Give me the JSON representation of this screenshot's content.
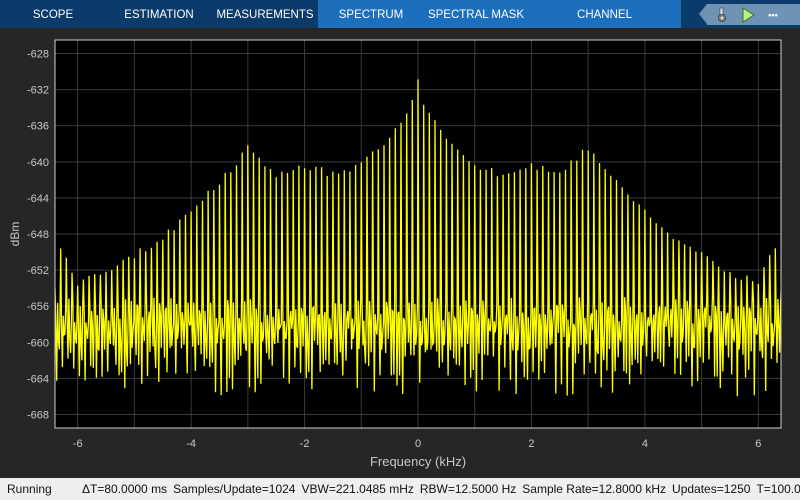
{
  "tabs": [
    {
      "label": "SCOPE",
      "active": false
    },
    {
      "label": "ESTIMATION",
      "active": false
    },
    {
      "label": "MEASUREMENTS",
      "active": false
    },
    {
      "label": "SPECTRUM",
      "active": true
    },
    {
      "label": "SPECTRAL MASK",
      "active": true
    },
    {
      "label": "CHANNEL MEASUREMENTS",
      "active": true
    }
  ],
  "toolbar": {
    "icons": [
      "settings-icon",
      "run-icon",
      "more-icon"
    ],
    "more_label": "•••"
  },
  "colors": {
    "tabbar": "#0b3b6a",
    "tab_active": "#1c6fbd",
    "trace": "#ffff00",
    "plot_bg": "#000000",
    "figure_bg": "#262626",
    "status_bg": "#efefef"
  },
  "chart_data": {
    "type": "line",
    "title": "",
    "xlabel": "Frequency (kHz)",
    "ylabel": "dBm",
    "xlim": [
      -6.4,
      6.4
    ],
    "ylim": [
      -669.5,
      -626.5
    ],
    "xticks": [
      -6,
      -4,
      -2,
      0,
      2,
      4,
      6
    ],
    "yticks": [
      -628,
      -632,
      -636,
      -640,
      -644,
      -648,
      -652,
      -656,
      -660,
      -664,
      -668
    ],
    "grid": true,
    "series": [
      {
        "color": "#ffff00",
        "line_spacing_khz": 0.1,
        "peak_envelope": [
          [
            0,
            -630.5
          ],
          [
            0.1,
            -633
          ],
          [
            0.2,
            -634
          ],
          [
            0.5,
            -637
          ],
          [
            1,
            -640
          ],
          [
            1.5,
            -641
          ],
          [
            2,
            -640
          ],
          [
            2.5,
            -641
          ],
          [
            3,
            -638
          ],
          [
            3.5,
            -642
          ],
          [
            4,
            -645
          ],
          [
            4.5,
            -648
          ],
          [
            5,
            -650
          ],
          [
            5.5,
            -652
          ],
          [
            6,
            -653
          ],
          [
            6.3,
            -649
          ],
          [
            6.4,
            -654
          ]
        ],
        "noise_floor_upper": -655,
        "trough_range": [
          -666,
          -660
        ]
      }
    ]
  },
  "status": {
    "state": "Running",
    "items": [
      "ΔT=80.0000 ms",
      "Samples/Update=1024",
      "VBW=221.0485 mHz",
      "RBW=12.5000 Hz",
      "Sample Rate=12.8000 kHz",
      "Updates=1250",
      "T=100.0"
    ]
  }
}
